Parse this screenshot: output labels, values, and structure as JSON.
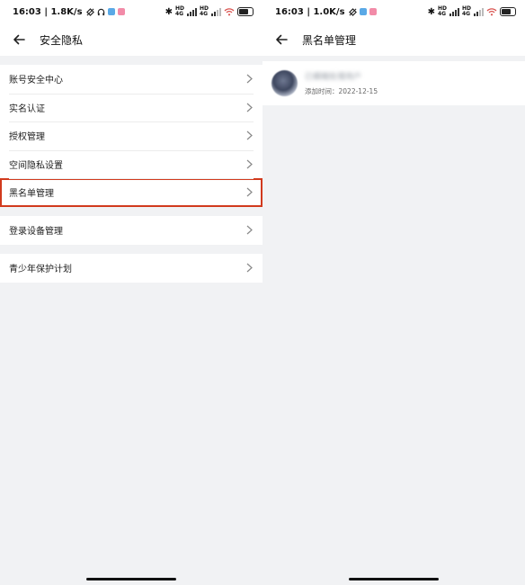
{
  "left_screen": {
    "status": {
      "time_speed": "16:03 | 1.8K/s"
    },
    "header": {
      "title": "安全隐私"
    },
    "group1": [
      {
        "label": "账号安全中心"
      },
      {
        "label": "实名认证"
      },
      {
        "label": "授权管理"
      },
      {
        "label": "空间隐私设置"
      },
      {
        "label": "黑名单管理",
        "highlighted": true
      }
    ],
    "group2": [
      {
        "label": "登录设备管理"
      }
    ],
    "group3": [
      {
        "label": "青少年保护计划"
      }
    ]
  },
  "right_screen": {
    "status": {
      "time_speed": "16:03 | 1.0K/s"
    },
    "header": {
      "title": "黑名单管理"
    },
    "blacklist": [
      {
        "name": "已模糊处理用户",
        "added_time": "添加时间：2022-12-15"
      }
    ]
  },
  "colors": {
    "highlight": "#d13a1d",
    "background": "#f1f2f4"
  },
  "icons": [
    "back-arrow-icon",
    "chevron-right-icon",
    "bluetooth-icon",
    "signal-icon",
    "wifi-icon",
    "battery-icon"
  ]
}
